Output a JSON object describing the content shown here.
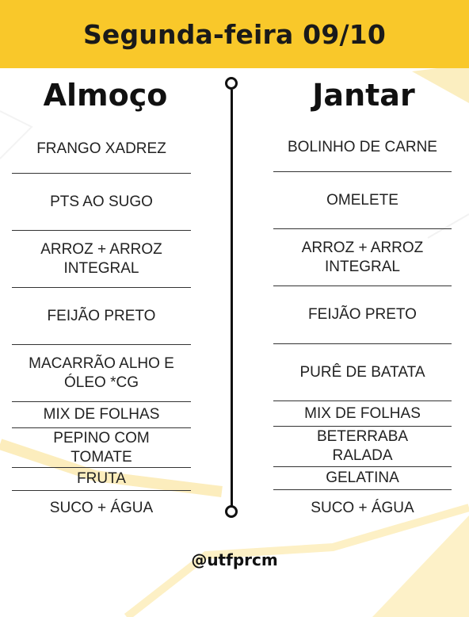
{
  "header": {
    "title": "Segunda-feira 09/10"
  },
  "lunch": {
    "title": "Almoço",
    "items": [
      "FRANGO XADREZ",
      "PTS AO SUGO",
      "ARROZ + ARROZ\nINTEGRAL",
      "FEIJÃO PRETO",
      "MACARRÃO ALHO E\nÓLEO *CG",
      "MIX DE FOLHAS",
      "PEPINO COM\nTOMATE",
      "FRUTA",
      "SUCO + ÁGUA"
    ]
  },
  "dinner": {
    "title": "Jantar",
    "items": [
      "BOLINHO DE CARNE",
      "OMELETE",
      "ARROZ + ARROZ\nINTEGRAL",
      "FEIJÃO PRETO",
      "PURÊ DE BATATA",
      "MIX DE FOLHAS",
      "BETERRABA\nRALADA",
      "GELATINA",
      "SUCO + ÁGUA"
    ]
  },
  "footer": {
    "handle": "@utfprcm"
  },
  "colors": {
    "header": "#f9c82a",
    "decor": "#fbe7a3",
    "text": "#222222"
  }
}
